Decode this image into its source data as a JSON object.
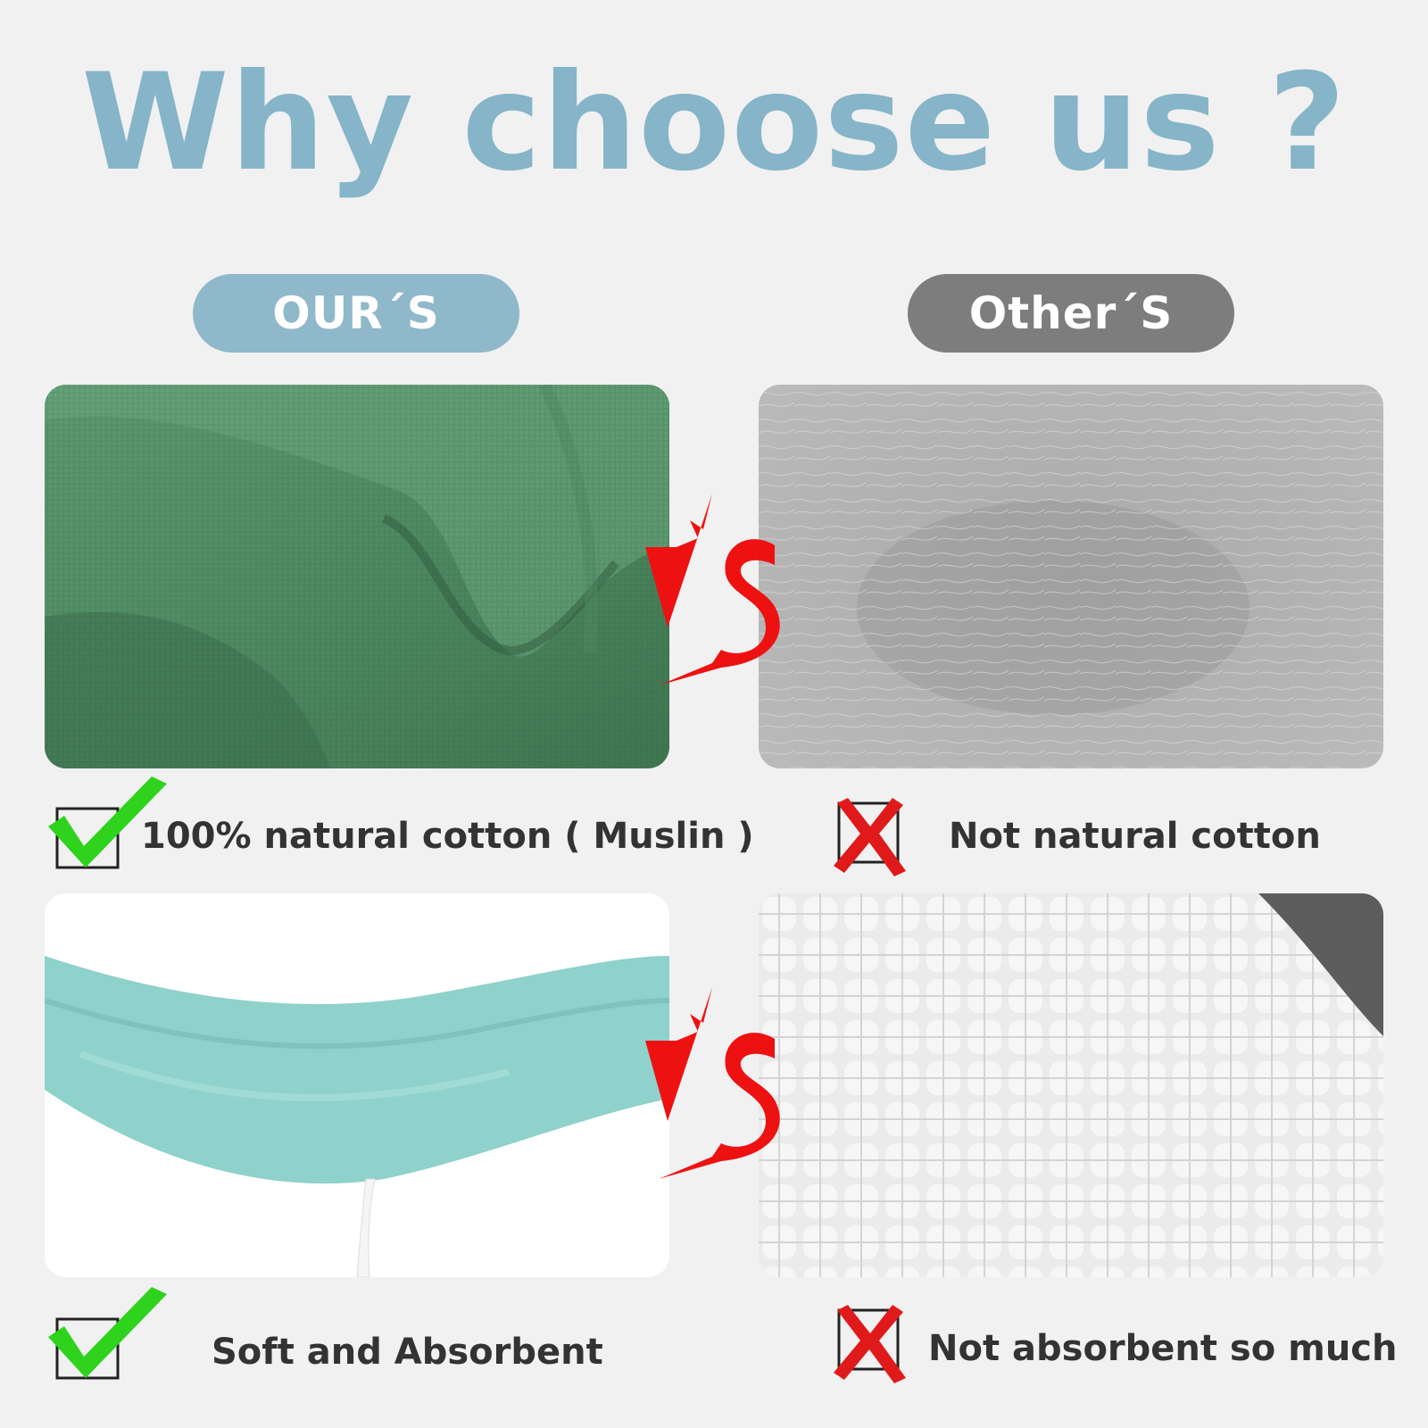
{
  "title": "Why choose us ?",
  "colors": {
    "title": "#86b4c8",
    "ours_pill": "#8fb8ca",
    "others_pill": "#7d7d7d",
    "check": "#2fd21c",
    "cross": "#e01a1a",
    "vs": "#ee1111",
    "caption": "#333333",
    "background": "#f1f1f1"
  },
  "labels": {
    "ours": "OUR´S",
    "others": "Other´S"
  },
  "comparisons": [
    {
      "ours_caption": "100% natural cotton ( Muslin )",
      "ours_mark": "check-icon",
      "others_caption": "Not natural cotton",
      "others_mark": "cross-icon",
      "vs": "VS"
    },
    {
      "ours_caption": "Soft and Absorbent",
      "ours_mark": "check-icon",
      "others_caption": "Not absorbent so much",
      "others_mark": "cross-icon",
      "vs": "VS"
    }
  ]
}
